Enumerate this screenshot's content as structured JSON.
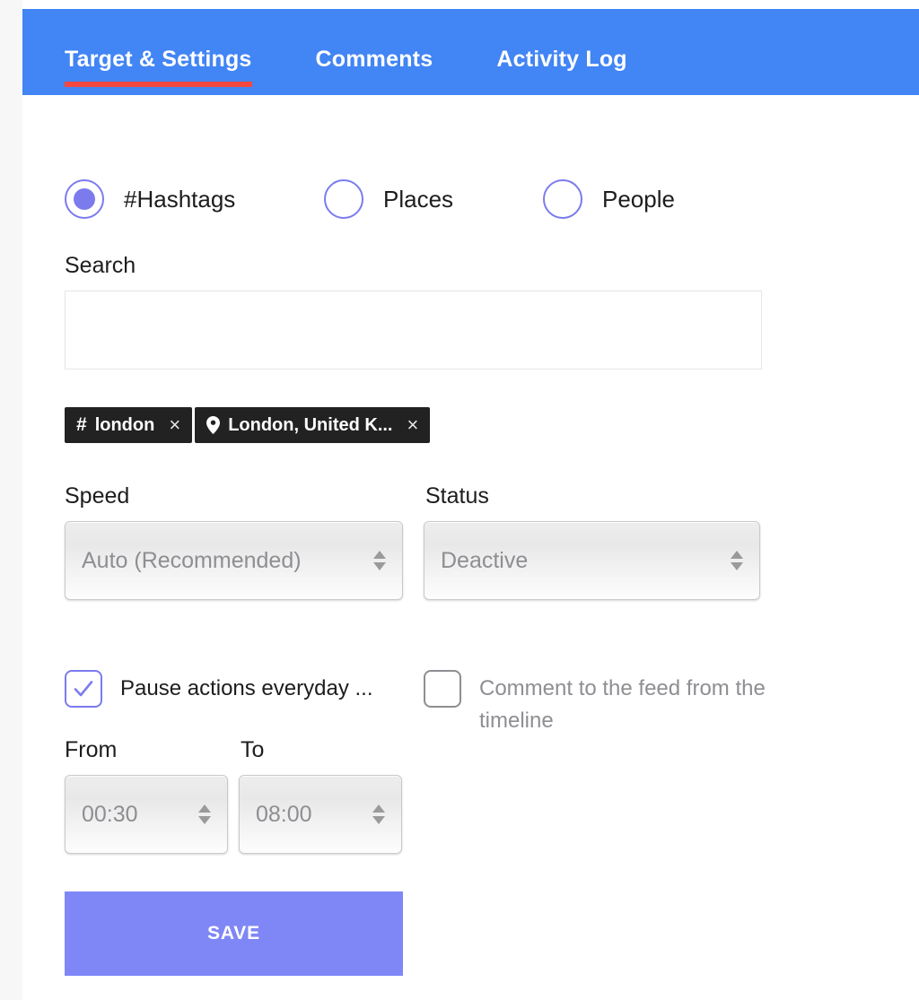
{
  "theme": {
    "header_blue": "#4285f4",
    "active_tab_underline": "#f4473f",
    "accent_purple": "#7b7bee",
    "save_button": "#7f87f7",
    "tag_dark": "#222222",
    "muted_text": "#8e8e93"
  },
  "tabs": [
    {
      "label": "Target & Settings",
      "active": true
    },
    {
      "label": "Comments",
      "active": false
    },
    {
      "label": "Activity Log",
      "active": false
    }
  ],
  "target_type": {
    "options": [
      {
        "label": "#Hashtags",
        "selected": true
      },
      {
        "label": "Places",
        "selected": false
      },
      {
        "label": "People",
        "selected": false
      }
    ]
  },
  "search": {
    "label": "Search",
    "value": "",
    "placeholder": ""
  },
  "tags": [
    {
      "icon": "hash-icon",
      "glyph": "#",
      "label": "london",
      "close": "×"
    },
    {
      "icon": "location-pin-icon",
      "glyph": "",
      "label": "London, United K...",
      "close": "×"
    }
  ],
  "speed": {
    "label": "Speed",
    "value": "Auto (Recommended)"
  },
  "status": {
    "label": "Status",
    "value": "Deactive"
  },
  "pause_actions": {
    "label": "Pause actions everyday ...",
    "checked": true
  },
  "comment_feed": {
    "label": "Comment to the feed from the timeline",
    "checked": false
  },
  "from": {
    "label": "From",
    "value": "00:30"
  },
  "to": {
    "label": "To",
    "value": "08:00"
  },
  "save": {
    "label": "SAVE"
  }
}
